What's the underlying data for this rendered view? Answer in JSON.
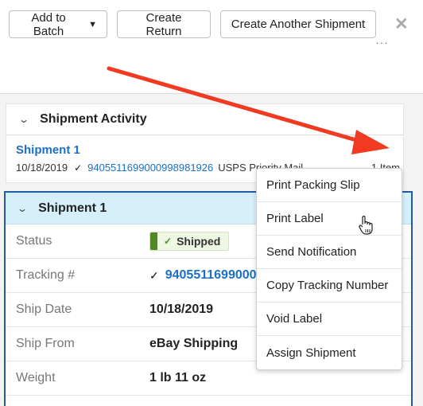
{
  "toolbar": {
    "add_to_batch": "Add to Batch",
    "add_to_batch_caret": "▼",
    "create_return": "Create Return",
    "create_another_shipment": "Create Another Shipment",
    "close_icon": "✕"
  },
  "activity": {
    "title": "Shipment Activity",
    "chevron": "⌄",
    "shipment_name": "Shipment 1",
    "date": "10/18/2019",
    "check": "✓",
    "tracking_number": "9405511699000998981926",
    "carrier": "USPS Priority Mail",
    "items": "1 Item",
    "more_icon": "···"
  },
  "detail": {
    "title": "Shipment 1",
    "chevron": "⌄",
    "fields": [
      {
        "label": "Status",
        "value": "Shipped"
      },
      {
        "label": "Tracking #",
        "value": "9405511699000998981926"
      },
      {
        "label": "Ship Date",
        "value": "10/18/2019"
      },
      {
        "label": "Ship From",
        "value": "eBay Shipping"
      },
      {
        "label": "Weight",
        "value": "1 lb 11 oz"
      }
    ],
    "status_check": "✓",
    "tracking_check": "✓"
  },
  "menu": {
    "items": [
      "Print Packing Slip",
      "Print Label",
      "Send Notification",
      "Copy Tracking Number",
      "Void Label",
      "Assign Shipment"
    ]
  },
  "colors": {
    "link": "#1a6fc8",
    "selected_border": "#1f5ba6",
    "selected_header": "#d6f0fb",
    "status_green": "#4e8a23",
    "annotation_arrow": "#f03a22"
  }
}
